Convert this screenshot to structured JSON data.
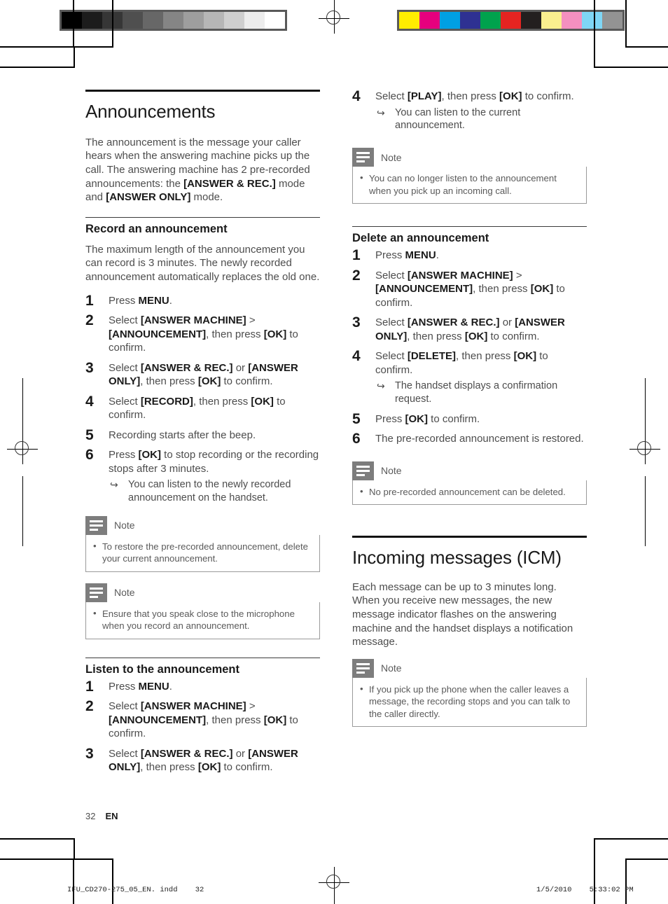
{
  "calibration": {
    "gray_patches": [
      "#000000",
      "#1c1c1c",
      "#363636",
      "#4f4f4f",
      "#676767",
      "#858585",
      "#9e9e9e",
      "#b6b6b6",
      "#cfcfcf",
      "#ededed",
      "#ffffff"
    ],
    "color_patches": [
      "#ffed00",
      "#e6007e",
      "#00a0e3",
      "#2e3192",
      "#00a24d",
      "#e52421",
      "#231f1f",
      "#faef8f",
      "#f490c0",
      "#7fd6f5",
      "#939393"
    ]
  },
  "left_column": {
    "title": "Announcements",
    "intro_1": "The announcement is the message your caller hears when the answering machine picks up the call. The answering machine has 2 pre-recorded announcements: the ",
    "intro_bold_1": "[ANSWER & REC.]",
    "intro_2": " mode and ",
    "intro_bold_2": "[ANSWER ONLY]",
    "intro_3": " mode.",
    "record": {
      "heading": "Record an announcement",
      "paragraph": "The maximum length of the announcement you can record is 3 minutes. The newly recorded announcement automatically replaces the old one.",
      "steps": [
        {
          "num": "1",
          "html": "Press <b>MENU</b>."
        },
        {
          "num": "2",
          "html": "Select <b>[ANSWER MACHINE]</b> &gt; <b>[ANNOUNCEMENT]</b>, then press <b>[OK]</b> to confirm."
        },
        {
          "num": "3",
          "html": "Select <b>[ANSWER &amp; REC.]</b> or <b>[ANSWER ONLY]</b>, then press <b>[OK]</b> to confirm."
        },
        {
          "num": "4",
          "html": "Select <b>[RECORD]</b>, then press <b>[OK]</b> to confirm."
        },
        {
          "num": "5",
          "html": "Recording starts after the beep."
        },
        {
          "num": "6",
          "html": "Press <b>[OK]</b> to stop recording or the recording stops after 3 minutes.",
          "sub": "You can listen to the newly recorded announcement on the handset."
        }
      ]
    },
    "note_1": {
      "label": "Note",
      "items": [
        "To restore the pre-recorded announcement, delete your current announcement."
      ]
    },
    "note_2": {
      "label": "Note",
      "items": [
        "Ensure that you speak close to the microphone when you record an announcement."
      ]
    },
    "listen": {
      "heading": "Listen to the announcement",
      "steps": [
        {
          "num": "1",
          "html": "Press <b>MENU</b>."
        },
        {
          "num": "2",
          "html": "Select <b>[ANSWER MACHINE]</b> &gt; <b>[ANNOUNCEMENT]</b>, then press <b>[OK]</b> to confirm."
        },
        {
          "num": "3",
          "html": "Select <b>[ANSWER &amp; REC.]</b> or <b>[ANSWER ONLY]</b>, then press <b>[OK]</b> to confirm."
        }
      ]
    }
  },
  "right_column": {
    "listen_continued": {
      "steps": [
        {
          "num": "4",
          "html": "Select <b>[PLAY]</b>, then press <b>[OK]</b> to confirm.",
          "sub": "You can listen to the current announcement."
        }
      ]
    },
    "note_1": {
      "label": "Note",
      "items": [
        "You can no longer listen to the announcement when you pick up an incoming call."
      ]
    },
    "delete": {
      "heading": "Delete an announcement",
      "steps": [
        {
          "num": "1",
          "html": "Press <b>MENU</b>."
        },
        {
          "num": "2",
          "html": "Select <b>[ANSWER MACHINE]</b> &gt; <b>[ANNOUNCEMENT]</b>, then press <b>[OK]</b> to confirm."
        },
        {
          "num": "3",
          "html": "Select <b>[ANSWER &amp; REC.]</b> or <b>[ANSWER ONLY]</b>, then press <b>[OK]</b> to confirm."
        },
        {
          "num": "4",
          "html": "Select <b>[DELETE]</b>, then press <b>[OK]</b> to confirm.",
          "sub": "The handset displays a confirmation request."
        },
        {
          "num": "5",
          "html": "Press <b>[OK]</b> to confirm."
        },
        {
          "num": "6",
          "html": "The pre-recorded announcement is restored."
        }
      ]
    },
    "note_2": {
      "label": "Note",
      "items": [
        "No pre-recorded announcement can be deleted."
      ]
    },
    "icm": {
      "title": "Incoming messages (ICM)",
      "paragraph": "Each message can be up to 3 minutes long. When you receive new messages, the new message indicator flashes on the answering machine and the handset displays a notification message."
    },
    "note_3": {
      "label": "Note",
      "items": [
        "If you pick up the phone when the caller leaves a message, the recording stops and you can talk to the caller directly."
      ]
    }
  },
  "page_footer": {
    "page_number": "32",
    "language": "EN"
  },
  "print_footer": {
    "file": "IFU_CD270-275_05_EN. indd    32",
    "timestamp": "1/5/2010    5:33:02 PM"
  }
}
